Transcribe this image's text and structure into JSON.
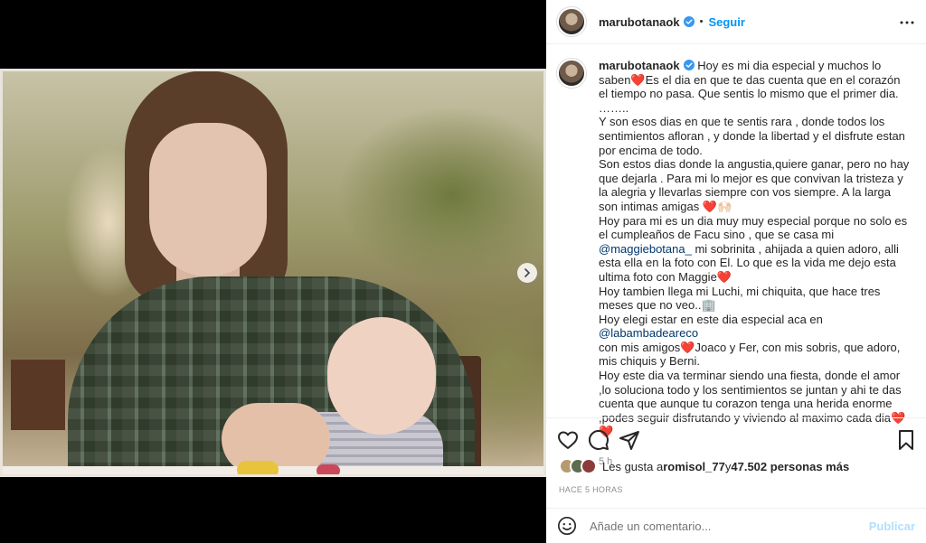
{
  "post": {
    "username": "marubotanaok",
    "follow_label": "Seguir",
    "dot": "•",
    "caption": {
      "lines": [
        [
          {
            "t": "Hoy es mi dia especial y muchos lo saben❤️Es el dia en que te das cuenta que en el corazón el tiempo no pasa. Que sentis lo mismo que el primer dia. ……..\nY son esos dias en que te sentis rara , donde todos los sentimientos afloran , y donde la libertad y el disfrute estan por encima de todo.\nSon estos dias donde la angustia,quiere ganar, pero no hay que dejarla . Para mi lo mejor es que convivan la tristeza y la alegria y llevarlas siempre con vos siempre. A la larga son intimas amigas ❤️🙌🏻\nHoy para mi es un dia muy muy especial porque no solo es el cumpleaños de Facu sino , que se casa mi "
          },
          {
            "m": "@maggiebotana_"
          },
          {
            "t": " mi sobrinita , ahijada a quien adoro, alli esta ella en la foto con El. Lo que es la vida me dejo esta ultima foto con Maggie❤️\nHoy tambien llega mi Luchi, mi chiquita, que hace tres meses que no veo..🏢\nHoy elegi estar en este dia especial aca en "
          },
          {
            "m": "@labambadeareco"
          },
          {
            "t": "\ncon mis amigos❤️Joaco y Fer, con mis sobris, que adoro, mis chiquis y Berni.\nHoy este dia va terminar siendo una fiesta, donde el amor ,lo soluciona todo y los sentimientos se juntan y ahi te das cuenta que aunque tu corazon tenga una herida enorme ,podes seguir disfrutando y viviendo al maximo cada dia❤️❤️"
          }
        ]
      ]
    },
    "time_ago": "5 h",
    "likes_prefix": "Les gusta a ",
    "likes_user": "romisol_77",
    "likes_mid": " y ",
    "likes_count": "47.502 personas más",
    "posted_label": "HACE 5 HORAS",
    "comment_placeholder": "Añade un comentario...",
    "publish_label": "Publicar"
  },
  "icons": {
    "more": "more-options-icon",
    "verified": "verified-badge-icon",
    "like": "heart-icon",
    "comment": "comment-icon",
    "share": "paper-plane-icon",
    "save": "bookmark-icon",
    "emoji": "emoji-icon",
    "next": "chevron-right-icon"
  },
  "colors": {
    "accent": "#0095f6",
    "mention": "#00376b",
    "muted": "#8e8e8e",
    "publish_disabled": "#b2dffc"
  }
}
